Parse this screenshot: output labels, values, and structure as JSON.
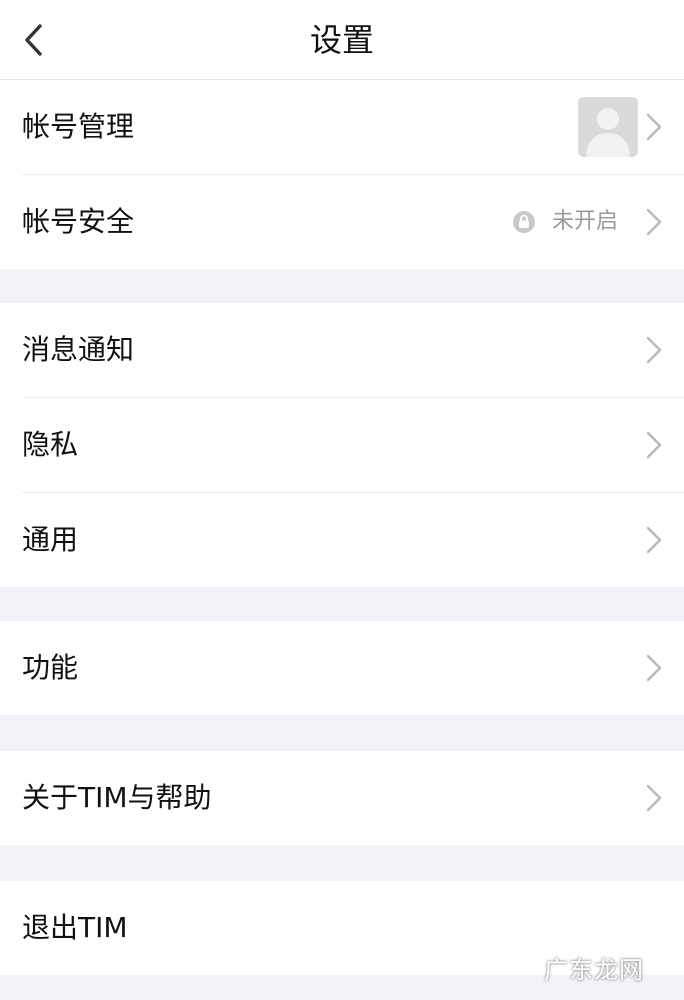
{
  "header": {
    "title": "设置",
    "back_icon": "chevron-left-icon"
  },
  "account": {
    "manage_label": "帐号管理",
    "security_label": "帐号安全",
    "security_status": "未开启"
  },
  "notifications": {
    "messages_label": "消息通知",
    "privacy_label": "隐私",
    "general_label": "通用"
  },
  "features": {
    "label": "功能"
  },
  "about": {
    "label": "关于TIM与帮助"
  },
  "logout": {
    "label": "退出TIM"
  },
  "watermark": {
    "text": "广东龙网"
  },
  "colors": {
    "background": "#ffffff",
    "section_gap": "#f2f3f7",
    "chevron": "#b8b8b8",
    "muted_text": "#9a9a9a"
  }
}
